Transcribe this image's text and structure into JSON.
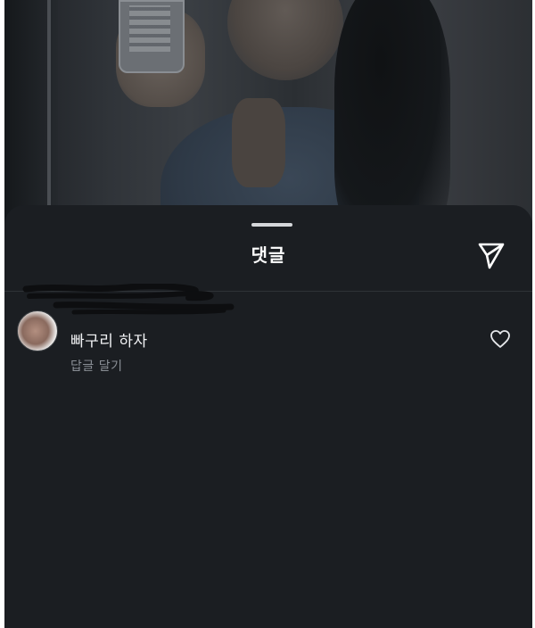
{
  "sheet": {
    "title": "댓글",
    "share_icon": "paper-plane-icon"
  },
  "comments": [
    {
      "username": "",
      "text": "빠구리 하자",
      "reply_label": "답글 달기",
      "like_icon": "heart-outline-icon"
    }
  ],
  "colors": {
    "sheet_background": "#1b1e22",
    "title_text": "#ffffff",
    "secondary_text": "#8a8f96",
    "divider": "#2f3337"
  }
}
